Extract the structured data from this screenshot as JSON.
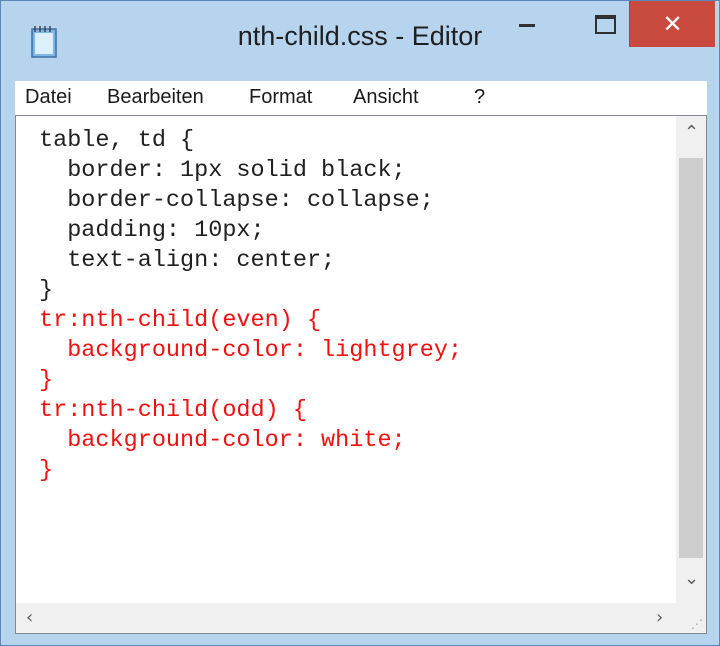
{
  "window": {
    "title": "nth-child.css - Editor",
    "icon": "notepad-icon",
    "close_symbol": "✕"
  },
  "menu": {
    "items": [
      "Datei",
      "Bearbeiten",
      "Format",
      "Ansicht",
      "?"
    ]
  },
  "editor": {
    "lines": [
      {
        "text": "table, td {",
        "color": "#202020"
      },
      {
        "text": "  border: 1px solid black;",
        "color": "#202020"
      },
      {
        "text": "  border-collapse: collapse;",
        "color": "#202020"
      },
      {
        "text": "  padding: 10px;",
        "color": "#202020"
      },
      {
        "text": "  text-align: center;",
        "color": "#202020"
      },
      {
        "text": "}",
        "color": "#202020"
      },
      {
        "text": "tr:nth-child(even) {",
        "color": "#f01010"
      },
      {
        "text": "  background-color: lightgrey;",
        "color": "#f01010"
      },
      {
        "text": "}",
        "color": "#f01010"
      },
      {
        "text": "tr:nth-child(odd) {",
        "color": "#f01010"
      },
      {
        "text": "  background-color: white;",
        "color": "#f01010"
      },
      {
        "text": "}",
        "color": "#f01010"
      }
    ]
  },
  "colors": {
    "titlebar": "#b7d4ef",
    "close_button": "#c94a3f",
    "highlight_text": "#f01010"
  }
}
